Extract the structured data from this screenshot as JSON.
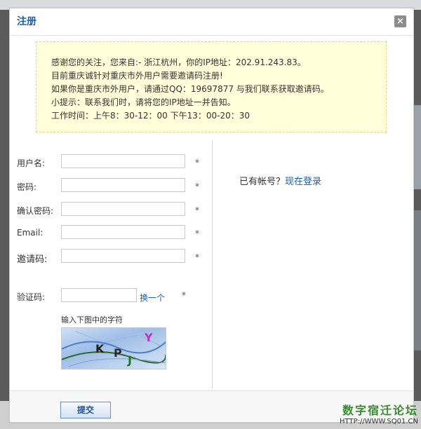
{
  "dialog": {
    "title": "注册",
    "close_symbol": "×"
  },
  "notice": {
    "lines": [
      "感谢您的关注，您来自:- 浙江杭州，你的IP地址：202.91.243.83。",
      "目前重庆诚针对重庆市外用户需要邀请码注册!",
      "如果你是重庆市外用户，请通过QQ：19697877 与我们联系获取邀请码。",
      "小提示：联系我们时，请将您的IP地址一并告知。",
      "工作时间：上午8：30-12：00 下午13：00-20：30"
    ]
  },
  "form": {
    "username_label": "用户名:",
    "password_label": "密码:",
    "confirm_password_label": "确认密码:",
    "email_label": "Email:",
    "invite_code_label": "邀请码:",
    "captcha_label": "验证码:",
    "required_mark": "*",
    "username_value": "",
    "password_value": "",
    "confirm_password_value": "",
    "email_value": "",
    "invite_code_value": "",
    "captcha_value": "",
    "captcha_refresh": "换一个",
    "captcha_hint": "输入下图中的字符",
    "captcha_chars": [
      "K",
      "P",
      "J",
      "Y"
    ]
  },
  "login": {
    "prompt": "已有帐号？",
    "link": "现在登录"
  },
  "footer": {
    "submit_label": "提交"
  },
  "watermark": {
    "text": "数字宿迁论坛",
    "url": "HTTP://WWW.SQ01.CN"
  },
  "colors": {
    "accent": "#1f5ea8",
    "notice_bg": "#ffffd9",
    "watermark_green": "#3a8a32"
  }
}
